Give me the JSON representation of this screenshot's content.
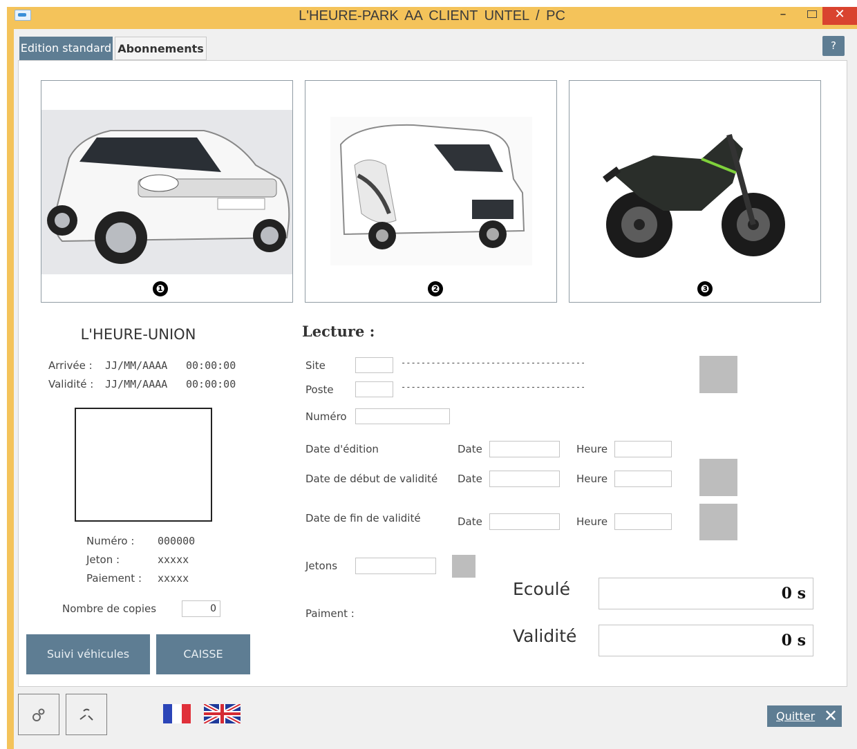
{
  "window": {
    "title": "L'HEURE-PARK   AA    CLIENT UNTEL  /  PC",
    "minimize": "–",
    "close": "✕"
  },
  "tabs": [
    {
      "label": "Edition standard",
      "active": true
    },
    {
      "label": "Abonnements",
      "active": false
    }
  ],
  "help_label": "?",
  "vehicles": [
    {
      "icon": "car-photo",
      "badge": "❶"
    },
    {
      "icon": "camper-van-photo",
      "badge": "❷"
    },
    {
      "icon": "motorcycle-photo",
      "badge": "❸"
    }
  ],
  "ticket": {
    "title": "L'HEURE-UNION",
    "arrivee_label": "Arrivée :",
    "arrivee_date": "JJ/MM/AAAA",
    "arrivee_time": "00:00:00",
    "validite_label": "Validité :",
    "validite_date": "JJ/MM/AAAA",
    "validite_time": "00:00:00",
    "numero_label": "Numéro :",
    "numero_value": "000000",
    "jeton_label": "Jeton :",
    "jeton_value": "xxxxx",
    "paiement_label": "Paiement :",
    "paiement_value": "xxxxx",
    "copies_label": "Nombre de copies",
    "copies_value": "0"
  },
  "buttons": {
    "suivi": "Suivi véhicules",
    "caisse": "CAISSE",
    "quit": "Quitter",
    "quit_icon": "✕"
  },
  "lecture": {
    "title": "Lecture :",
    "site_label": "Site",
    "poste_label": "Poste",
    "dashes": "------------------------------------------",
    "numero_label": "Numéro",
    "date_edition_label": "Date d'édition",
    "date_debut_label": "Date de début de validité",
    "date_fin_label": "Date de fin de validité",
    "date_label": "Date",
    "heure_label": "Heure",
    "jetons_label": "Jetons",
    "paiment_label": "Paiment :"
  },
  "timers": {
    "ecoule_label": "Ecoulé",
    "ecoule_value": "0 s",
    "validite_label": "Validité",
    "validite_value": "0 s"
  },
  "toolbar": {
    "settings_icon": "gears-icon",
    "tools_icon": "tools-icon",
    "flags": [
      "french-flag-icon",
      "uk-flag-icon"
    ]
  },
  "colors": {
    "title_bar": "#f4c35a",
    "accent": "#5e7d93",
    "close": "#d9432f",
    "status_square": "#bdbdbd"
  }
}
